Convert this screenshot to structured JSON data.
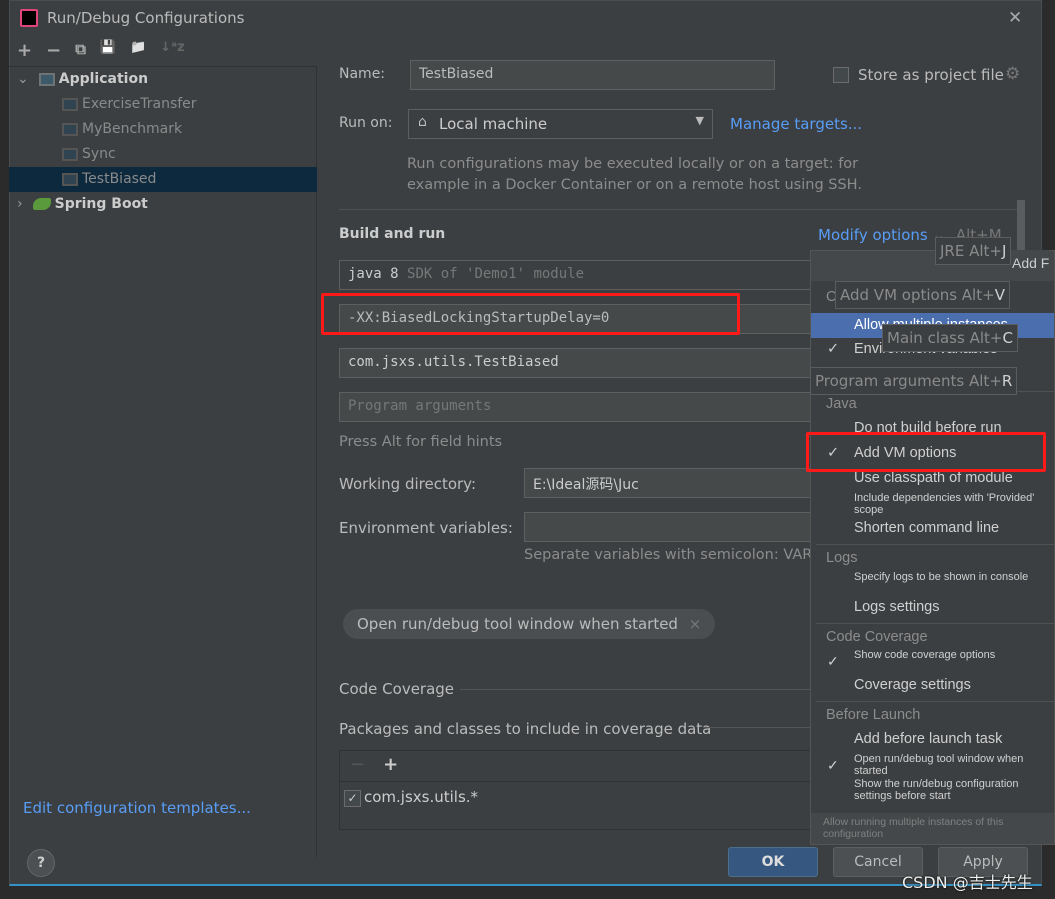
{
  "window": {
    "title": "Run/Debug Configurations",
    "close": "✕"
  },
  "toolbar": {
    "add": "+",
    "remove": "−",
    "copy": "⧉",
    "save": "💾",
    "folder": "📁",
    "sort": "↓ᵃz"
  },
  "tree": {
    "application": {
      "label": "Application",
      "children": [
        "ExerciseTransfer",
        "MyBenchmark",
        "Sync",
        "TestBiased"
      ],
      "selected": "TestBiased"
    },
    "spring_boot": {
      "label": "Spring Boot"
    }
  },
  "edit_templates": "Edit configuration templates...",
  "form": {
    "name_label": "Name:",
    "name_value": "TestBiased",
    "store_label": "Store as project file",
    "store_checked": false,
    "run_on_label": "Run on:",
    "run_on_value": "Local machine",
    "manage_targets": "Manage targets...",
    "run_on_hint": "Run configurations may be executed locally or on a target: for example in a Docker Container or on a remote host using SSH.",
    "build_run": "Build and run",
    "modify_options": "Modify options",
    "modify_shortcut": "Alt+M",
    "jre": "java 8",
    "jre_hint": "SDK of 'Demo1' module",
    "vm_options": "-XX:BiasedLockingStartupDelay=0",
    "main_class": "com.jsxs.utils.TestBiased",
    "program_args_placeholder": "Program arguments",
    "field_hints": "Press Alt for field hints",
    "working_dir_label": "Working directory:",
    "working_dir_value": "E:\\Ideal源码\\Juc",
    "env_label": "Environment variables:",
    "env_value": "",
    "env_hint": "Separate variables with semicolon: VAR",
    "chip": "Open run/debug tool window when started",
    "code_coverage": "Code Coverage",
    "packages_label": "Packages and classes to include in coverage data",
    "coverage_entry": "com.jsxs.utils.*",
    "coverage_checked": true
  },
  "menu": {
    "partial_header": "O",
    "items_top": [
      {
        "label": "Allow multiple instances",
        "highlighted": true
      },
      {
        "label": "Environment variables",
        "checked": true
      }
    ],
    "sections": [
      {
        "title": "Java",
        "items": [
          {
            "label": "Do not build before run"
          },
          {
            "label": "Add VM options",
            "checked": true
          },
          {
            "label": "Use classpath of module"
          },
          {
            "label": "Include dependencies with 'Provided' scope"
          },
          {
            "label": "Shorten command line"
          }
        ]
      },
      {
        "title": "Logs",
        "items": [
          {
            "label": "Specify logs to be shown in console"
          },
          {
            "label": "Logs settings"
          }
        ]
      },
      {
        "title": "Code Coverage",
        "items": [
          {
            "label": "Show code coverage options",
            "checked": true
          },
          {
            "label": "Coverage settings"
          }
        ]
      },
      {
        "title": "Before Launch",
        "items": [
          {
            "label": "Add before launch task"
          },
          {
            "label": "Open run/debug tool window when started",
            "checked": true
          },
          {
            "label": "Show the run/debug configuration settings before start"
          }
        ]
      }
    ],
    "footer": "Allow running multiple instances of this configuration"
  },
  "tooltips": [
    {
      "text": "JRE Alt+",
      "key": "J"
    },
    {
      "text": "Add VM options Alt+",
      "key": "V"
    },
    {
      "text": "Main class Alt+",
      "key": "C"
    },
    {
      "text": "Program arguments Alt+",
      "key": "R"
    },
    {
      "text": "Add F",
      "key": ""
    }
  ],
  "buttons": {
    "help": "?",
    "ok": "OK",
    "cancel": "Cancel",
    "apply": "Apply"
  },
  "watermark": "CSDN @吉士先生",
  "colors": {
    "background": "#3c3f41",
    "accent": "#4b6eaf",
    "link": "#589df6",
    "highlight": "#ff1a1a"
  }
}
